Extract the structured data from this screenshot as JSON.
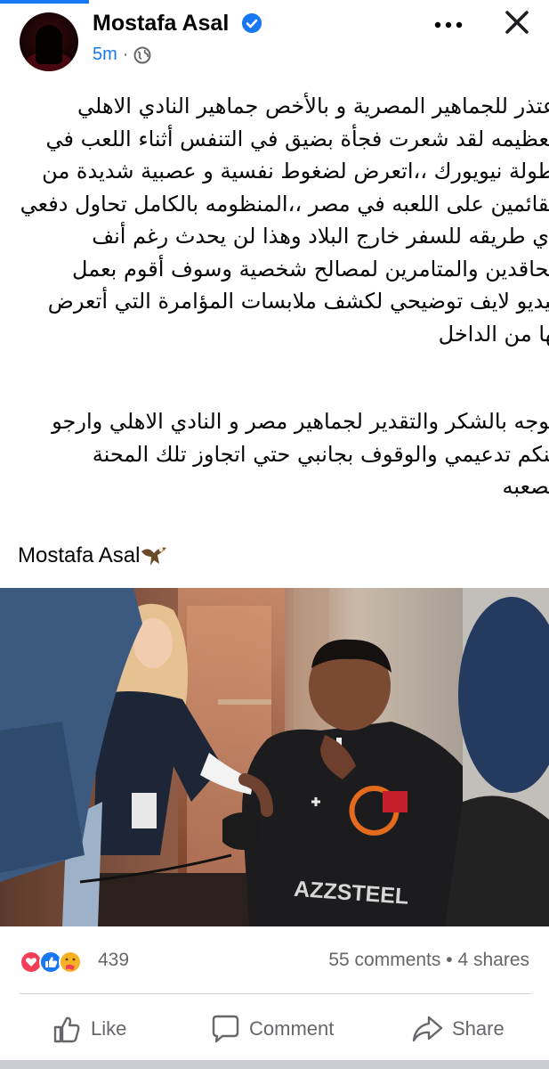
{
  "post": {
    "author": "Mostafa Asal",
    "time": "5m",
    "separator": "·",
    "paragraph1": "اعتذر للجماهير المصرية و بالأخص جماهير النادي الاهلي\nالعظيمه لقد شعرت فجأة بضيق في التنفس أثناء اللعب في\nبطولة نيويورك ،،اتعرض لضغوط نفسية و عصبية شديدة من\nالقائمين على اللعبه في مصر ،،المنظومه بالكامل تحاول دفعي\nباي طريقه للسفر خارج البلاد وهذا لن يحدث رغم أنف\nالحاقدين والمتامرين لمصالح شخصية وسوف أقوم بعمل\nفيديو لايف توضيحي لكشف ملابسات المؤامرة التي أتعرض\nلها من الداخل",
    "paragraph2": "أتوجه بالشكر والتقدير لجماهير مصر و  النادي الاهلي وارجو\nمنكم تدعيمي والوقوف بجانبي حتي اتجاوز تلك المحنة\nالصعبه",
    "signature": "Mostafa Asal",
    "jersey_text": "AZZSTEEL"
  },
  "stats": {
    "reaction_count": "439",
    "comments": "55 comments",
    "dot": "•",
    "shares": "4 shares"
  },
  "actions": {
    "like": "Like",
    "comment": "Comment",
    "share": "Share"
  },
  "icons": {
    "verified": "verified-badge-icon",
    "globe": "globe-icon",
    "more": "more-options-icon",
    "close": "close-icon",
    "eagle": "eagle-emoji-icon",
    "reactions": [
      "love-reaction-icon",
      "like-reaction-icon",
      "care-reaction-icon"
    ]
  },
  "colors": {
    "brand": "#1877f2",
    "text": "#050505",
    "muted": "#65676b"
  }
}
